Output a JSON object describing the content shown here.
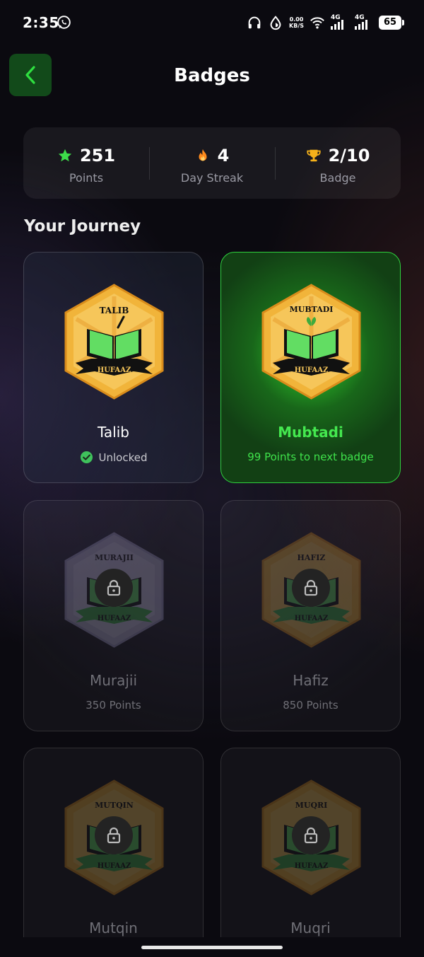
{
  "status_bar": {
    "time": "2:35",
    "net_speed_value": "0.00",
    "net_speed_unit": "KB/S",
    "signal1": "4G",
    "signal2": "4G",
    "battery": "65"
  },
  "header": {
    "title": "Badges"
  },
  "stats": [
    {
      "icon": "star-icon",
      "value": "251",
      "label": "Points",
      "color": "#3ddc4a"
    },
    {
      "icon": "flame-icon",
      "value": "4",
      "label": "Day Streak",
      "color": "#ff8a1c"
    },
    {
      "icon": "trophy-icon",
      "value": "2/10",
      "label": "Badge",
      "color": "#f5b11a"
    }
  ],
  "section_title": "Your Journey",
  "badges": [
    {
      "name": "Talib",
      "emblem_title": "TALIB",
      "banner": "HUFAAZ",
      "status": "Unlocked",
      "state": "unlocked",
      "color": "#f1b43a"
    },
    {
      "name": "Mubtadi",
      "emblem_title": "MUBTADI",
      "banner": "HUFAAZ",
      "status": "99 Points to next badge",
      "state": "current",
      "color": "#f1b43a"
    },
    {
      "name": "Murajii",
      "emblem_title": "MURAJII",
      "banner": "HUFAAZ",
      "status": "350 Points",
      "state": "locked",
      "color": "#b9b4d6"
    },
    {
      "name": "Hafiz",
      "emblem_title": "HAFIZ",
      "banner": "HUFAAZ",
      "status": "850 Points",
      "state": "locked",
      "color": "#f1b43a"
    },
    {
      "name": "Mutqin",
      "emblem_title": "MUTQIN",
      "banner": "HUFAAZ",
      "status": "",
      "state": "locked",
      "color": "#f1b43a"
    },
    {
      "name": "Muqri",
      "emblem_title": "MUQRI",
      "banner": "HUFAAZ",
      "status": "",
      "state": "locked",
      "color": "#f1b43a"
    }
  ]
}
